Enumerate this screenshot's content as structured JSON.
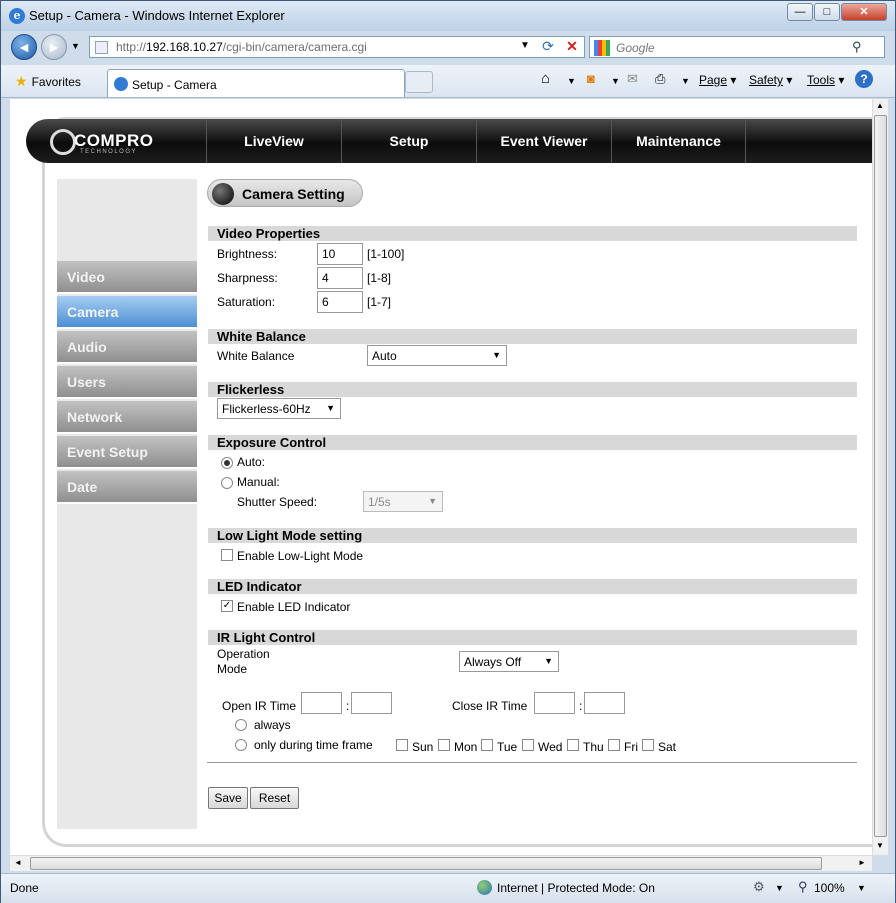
{
  "window": {
    "title": "Setup - Camera - Windows Internet Explorer",
    "minimize": "—",
    "maximize": "□",
    "close": "✕"
  },
  "address": {
    "url_prefix": "http://",
    "url_host": "192.168.10.27",
    "url_path": "/cgi-bin/camera/camera.cgi",
    "search_placeholder": "Google"
  },
  "commandbar": {
    "favorites": "Favorites",
    "tab_title": "Setup - Camera",
    "page": "Page",
    "safety": "Safety",
    "tools": "Tools"
  },
  "site": {
    "logo_name": "COMPRO",
    "logo_sub": "TECHNOLOGY",
    "nav": [
      "LiveView",
      "Setup",
      "Event Viewer",
      "Maintenance"
    ]
  },
  "sidebar": {
    "items": [
      {
        "label": "Video",
        "active": false
      },
      {
        "label": "Camera",
        "active": true
      },
      {
        "label": "Audio",
        "active": false
      },
      {
        "label": "Users",
        "active": false
      },
      {
        "label": "Network",
        "active": false
      },
      {
        "label": "Event Setup",
        "active": false
      },
      {
        "label": "Date",
        "active": false
      }
    ]
  },
  "main": {
    "title": "Camera Setting",
    "video_properties": {
      "heading": "Video Properties",
      "brightness_label": "Brightness:",
      "brightness_value": "10",
      "brightness_range": "[1-100]",
      "sharpness_label": "Sharpness:",
      "sharpness_value": "4",
      "sharpness_range": "[1-8]",
      "saturation_label": "Saturation:",
      "saturation_value": "6",
      "saturation_range": "[1-7]"
    },
    "white_balance": {
      "heading": "White Balance",
      "label": "White Balance",
      "value": "Auto"
    },
    "flickerless": {
      "heading": "Flickerless",
      "value": "Flickerless-60Hz"
    },
    "exposure": {
      "heading": "Exposure Control",
      "auto_label": "Auto:",
      "manual_label": "Manual:",
      "shutter_label": "Shutter Speed:",
      "shutter_value": "1/5s",
      "selected": "auto"
    },
    "low_light": {
      "heading": "Low Light Mode setting",
      "checkbox_label": "Enable Low-Light Mode",
      "checked": false
    },
    "led": {
      "heading": "LED Indicator",
      "checkbox_label": "Enable LED Indicator",
      "checked": true
    },
    "ir": {
      "heading": "IR Light Control",
      "operation_label_1": "Operation",
      "operation_label_2": "Mode",
      "operation_value": "Always Off",
      "open_label": "Open IR Time",
      "close_label": "Close IR Time",
      "colon": ":",
      "always_label": "always",
      "timeframe_label": "only during time frame",
      "days": [
        "Sun",
        "Mon",
        "Tue",
        "Wed",
        "Thu",
        "Fri",
        "Sat"
      ]
    },
    "buttons": {
      "save": "Save",
      "reset": "Reset"
    }
  },
  "status": {
    "left": "Done",
    "zone": "Internet | Protected Mode: On",
    "zoom": "100%"
  }
}
